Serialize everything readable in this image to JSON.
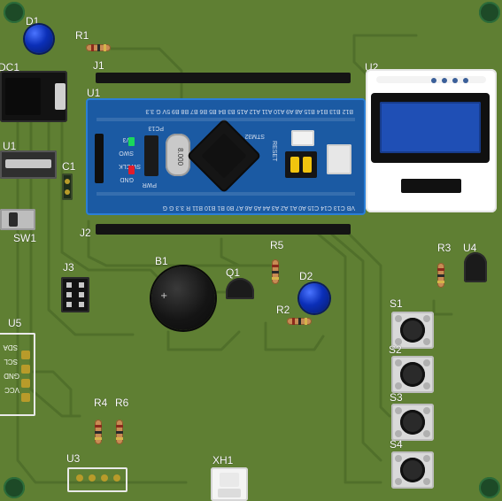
{
  "board": {
    "labels": {
      "D1": "D1",
      "R1": "R1",
      "DC1": "DC1",
      "J1": "J1",
      "U1": "U1",
      "U2": "U2",
      "C1": "C1",
      "SW1": "SW1",
      "J2": "J2",
      "B1": "B1",
      "R5": "R5",
      "Q1": "Q1",
      "D2": "D2",
      "R2": "R2",
      "R3": "R3",
      "U4": "U4",
      "J3": "J3",
      "U5": "U5",
      "S1": "S1",
      "S2": "S2",
      "S3": "S3",
      "S4": "S4",
      "R4": "R4",
      "R6": "R6",
      "U3": "U3",
      "XH1": "XH1"
    },
    "u5_pins": [
      "SDA",
      "SCL",
      "GND",
      "VCC"
    ],
    "bluepill": {
      "top_header_text": "B12 B13 B14 B15 A8 A9 A10 A11 A12 A15 B3 B4 B5 B6 B7 B8 B9 5V G 3.3",
      "bottom_header_text": "VB C13 C14 C15 A0 A1 A2 A3 A4 A5 A6 A7 B0 B1 B10 B11 R 3.3 G G",
      "left_debug_labels": [
        "3V3",
        "SWO",
        "SWCLK",
        "GND"
      ],
      "chip_text": "STM32",
      "crystal_text": "8.000",
      "pc13_text": "PC13",
      "pwr_text": "PWR",
      "reset_text": "RESET"
    }
  },
  "colors": {
    "board_green": "#5f7f33",
    "trace_green": "#4f6e2a",
    "bluepill_blue": "#1b5aa3",
    "oled_blue": "#1f4fb5",
    "oled_frame": "#ffffff",
    "led_blue": "#0b2fb8",
    "mount_hole": "#1d4a27"
  }
}
